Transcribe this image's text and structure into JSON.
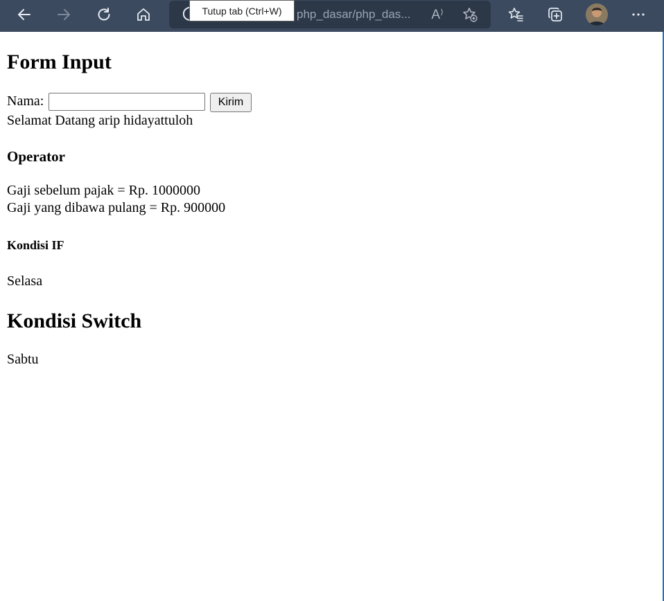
{
  "browser": {
    "tooltip": "Tutup tab (Ctrl+W)",
    "url_text": "php_dasar/php_das...",
    "read_aloud_glyph": "A⁾",
    "icons": [
      "back-icon",
      "forward-icon",
      "refresh-icon",
      "home-icon",
      "read-aloud-icon",
      "add-favorite-icon",
      "favorites-icon",
      "collections-icon",
      "profile-avatar",
      "more-icon"
    ],
    "colors": {
      "toolbar": "#3b4a5f",
      "address_bar": "#2c3848"
    }
  },
  "page": {
    "form_title": "Form Input",
    "name_label": "Nama:",
    "name_value": "",
    "submit_label": "Kirim",
    "welcome": "Selamat Datang arip hidayattuloh",
    "operator_title": "Operator",
    "gaji_before": "Gaji sebelum pajak = Rp. 1000000",
    "gaji_after": "Gaji yang dibawa pulang = Rp. 900000",
    "if_title": "Kondisi IF",
    "if_result": "Selasa",
    "switch_title": "Kondisi Switch",
    "switch_result": "Sabtu"
  }
}
